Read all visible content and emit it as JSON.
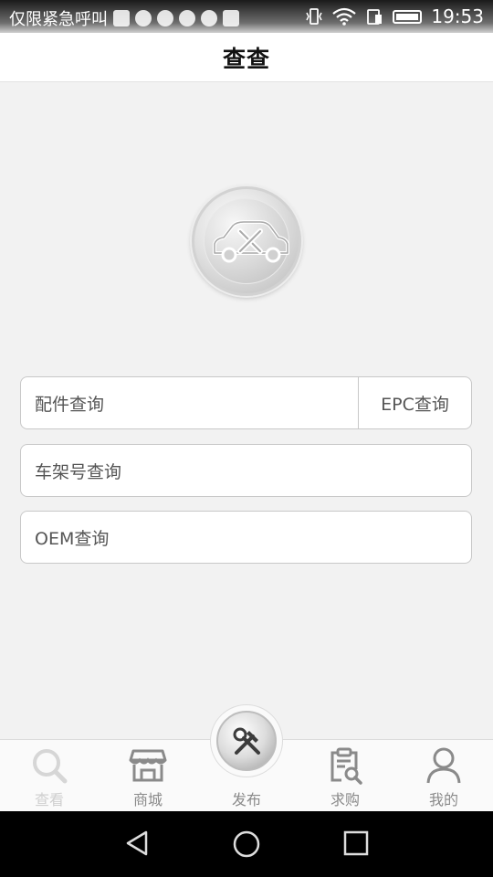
{
  "status_bar": {
    "carrier_text": "仅限紧急呼叫",
    "time": "19:53"
  },
  "header": {
    "title": "查查"
  },
  "search": {
    "parts_query": "配件查询",
    "epc_query": "EPC查询",
    "vin_query": "车架号查询",
    "oem_query": "OEM查询"
  },
  "tabbar": {
    "tabs": [
      {
        "label": "查看",
        "icon": "search-icon",
        "active": true
      },
      {
        "label": "商城",
        "icon": "store-icon",
        "active": false
      },
      {
        "label": "发布",
        "icon": "tools-icon",
        "active": false
      },
      {
        "label": "求购",
        "icon": "clipboard-search-icon",
        "active": false
      },
      {
        "label": "我的",
        "icon": "user-icon",
        "active": false
      }
    ]
  },
  "colors": {
    "background": "#f2f2f2",
    "border": "#c8c8c8",
    "label_text": "#555555",
    "active_tab": "#cfcfcf"
  }
}
